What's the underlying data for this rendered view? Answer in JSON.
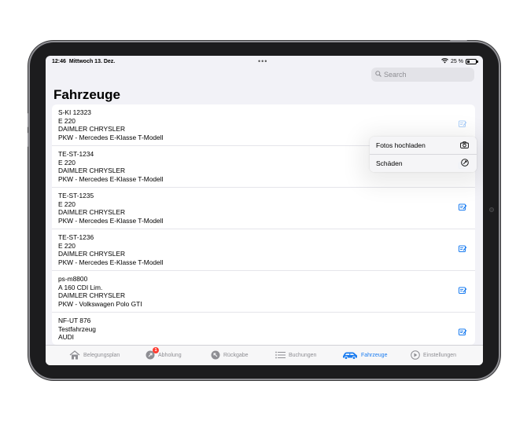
{
  "status": {
    "time": "12:46",
    "date": "Mittwoch 13. Dez.",
    "battery": "25 %",
    "battery_level": 0.25
  },
  "search": {
    "placeholder": "Search"
  },
  "page": {
    "title": "Fahrzeuge"
  },
  "vehicles": [
    {
      "plate": "S-KI 12323",
      "model": "E 220",
      "make": "DAIMLER CHRYSLER",
      "type": "PKW - Mercedes E-Klasse T-Modell"
    },
    {
      "plate": "TE-ST-1234",
      "model": "E 220",
      "make": "DAIMLER CHRYSLER",
      "type": "PKW - Mercedes E-Klasse T-Modell"
    },
    {
      "plate": "TE-ST-1235",
      "model": "E 220",
      "make": "DAIMLER CHRYSLER",
      "type": "PKW - Mercedes E-Klasse T-Modell"
    },
    {
      "plate": "TE-ST-1236",
      "model": "E 220",
      "make": "DAIMLER CHRYSLER",
      "type": "PKW - Mercedes E-Klasse T-Modell"
    },
    {
      "plate": "ps-m8800",
      "model": "A 160 CDI Lim.",
      "make": "DAIMLER CHRYSLER",
      "type": "PKW - Volkswagen Polo GTI"
    },
    {
      "plate": "NF-UT 876",
      "model": "Testfahrzeug",
      "make": "AUDI",
      "type": ""
    }
  ],
  "context_menu": {
    "items": [
      {
        "label": "Fotos hochladen",
        "icon": "camera-icon"
      },
      {
        "label": "Schäden",
        "icon": "damage-icon"
      }
    ]
  },
  "tabs": [
    {
      "label": "Belegungsplan",
      "icon": "house-icon"
    },
    {
      "label": "Abholung",
      "icon": "pickup-icon",
      "badge": "1"
    },
    {
      "label": "Rückgabe",
      "icon": "return-icon"
    },
    {
      "label": "Buchungen",
      "icon": "list-icon"
    },
    {
      "label": "Fahrzeuge",
      "icon": "car-icon",
      "active": true
    },
    {
      "label": "Einstellungen",
      "icon": "settings-icon"
    }
  ],
  "colors": {
    "accent": "#1a7cf0",
    "badge": "#ff3b30"
  }
}
